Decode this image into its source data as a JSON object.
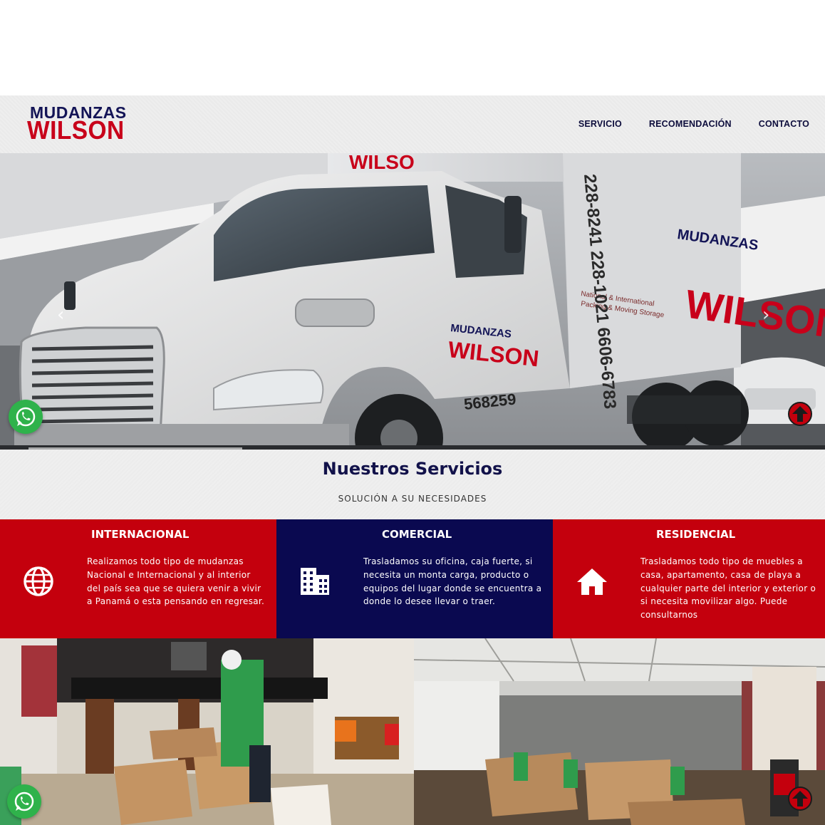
{
  "brand": {
    "logo_top": "MUDANZAS",
    "logo_bottom": "WILSON",
    "navy": "#131456",
    "red": "#c8001a"
  },
  "nav": {
    "items": [
      "SERVICIO",
      "RECOMENDACIÓN",
      "CONTACTO"
    ]
  },
  "hero": {
    "prev_icon": "chevron-left-icon",
    "next_icon": "chevron-right-icon",
    "truck_phone_lines": [
      "228-8241",
      "228-1021",
      "6606-6783"
    ],
    "truck_brand_top": "MUDANZAS",
    "truck_brand_bottom": "WILSON",
    "truck_tagline": "National & International Packing & Moving Storage",
    "truck_number": "568259"
  },
  "services": {
    "title": "Nuestros Servicios",
    "subtitle": "SOLUCIÓN A SU NECESIDADES",
    "cards": [
      {
        "title": "INTERNACIONAL",
        "icon": "globe-icon",
        "lines": [
          "Realizamos todo tipo de mudanzas",
          "Nacional e Internacional y al interior",
          "del país sea que se quiera venir a vivir",
          "a Panamá o esta pensando en regresar."
        ]
      },
      {
        "title": "COMERCIAL",
        "icon": "building-icon",
        "lines": [
          "Trasladamos su oficina, caja fuerte, si",
          "necesita un monta carga, producto o",
          "equipos del lugar donde se encuentra a",
          "donde lo desee llevar o traer."
        ]
      },
      {
        "title": "RESIDENCIAL",
        "icon": "home-icon",
        "lines": [
          "Trasladamos todo tipo de muebles a",
          "casa, apartamento, casa de playa a",
          "cualquier parte del interior y exterior o",
          "si necesita movilizar algo. Puede",
          "consultarnos"
        ]
      }
    ]
  },
  "colors": {
    "card_red": "#c4000d",
    "card_navy": "#0a0950",
    "whatsapp": "#2fb24b"
  },
  "floating": {
    "whatsapp_icon": "whatsapp-icon",
    "scroll_top_icon": "arrow-up-icon"
  }
}
